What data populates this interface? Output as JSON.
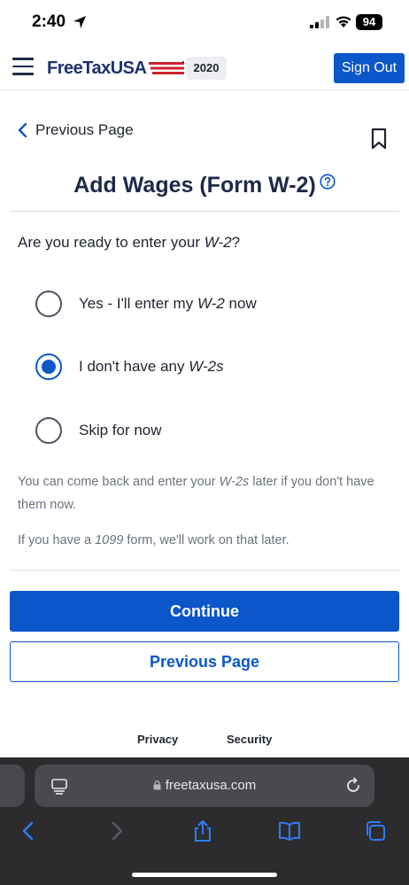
{
  "status_bar": {
    "time": "2:40",
    "battery": "94"
  },
  "header": {
    "logo_text": "FreeTaxUSA",
    "year": "2020",
    "sign_out_label": "Sign Out"
  },
  "nav": {
    "previous_link": "Previous Page"
  },
  "page": {
    "title": "Add Wages (Form W-2)",
    "question_prefix": "Are you ready to enter your ",
    "question_em": "W-2",
    "question_suffix": "?"
  },
  "options": [
    {
      "prefix": "Yes - I'll enter my ",
      "em": "W-2",
      "suffix": " now",
      "checked": false
    },
    {
      "prefix": "I don't have any ",
      "em": "W-2s",
      "suffix": "",
      "checked": true
    },
    {
      "prefix": "Skip for now",
      "em": "",
      "suffix": "",
      "checked": false
    }
  ],
  "help": {
    "line1_prefix": "You can come back and enter your ",
    "line1_em": "W-2s",
    "line1_suffix": " later if you don't have them now.",
    "line2_prefix": "If you have a ",
    "line2_em": "1099",
    "line2_suffix": " form, we'll work on that later."
  },
  "buttons": {
    "continue_label": "Continue",
    "previous_label": "Previous Page"
  },
  "footer": {
    "privacy": "Privacy",
    "security": "Security"
  },
  "browser": {
    "url": "freetaxusa.com"
  },
  "colors": {
    "primary": "#0b57c9",
    "navy": "#1c2a48",
    "flag_red": "#d0202e"
  }
}
